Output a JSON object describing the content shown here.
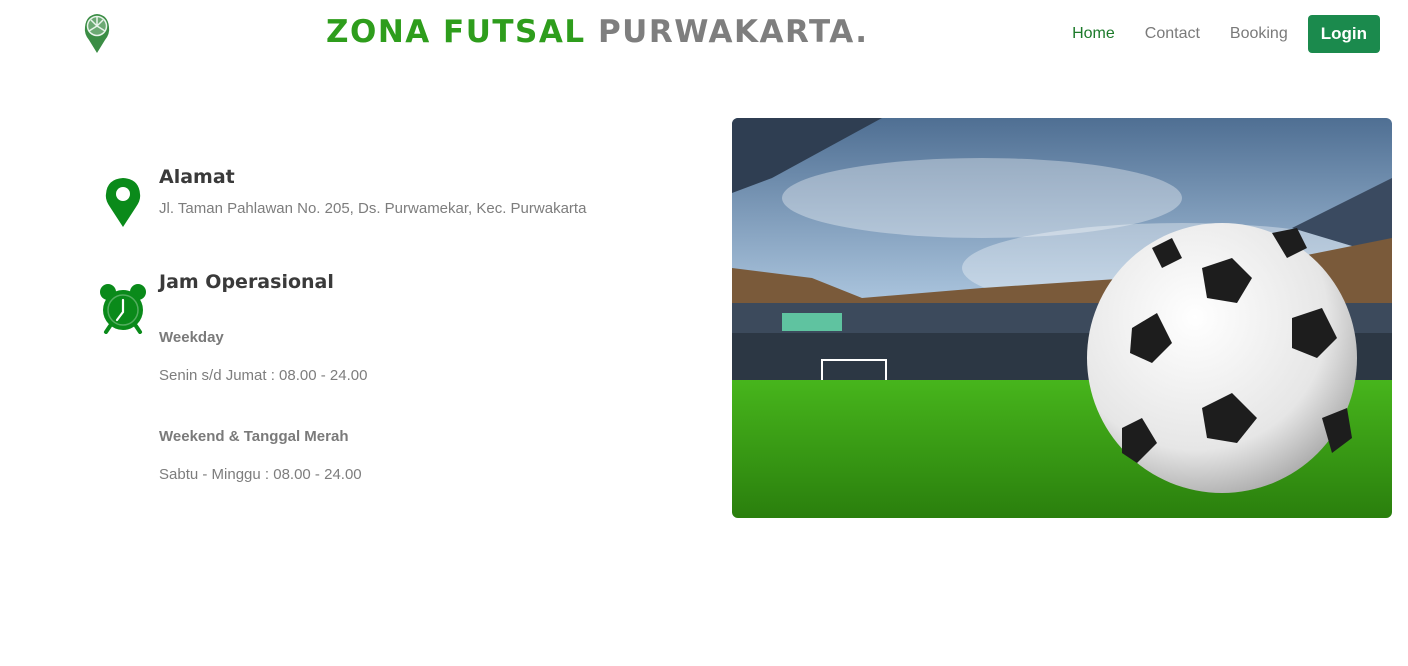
{
  "brand": {
    "part1": "ZONA FUTSAL",
    "part2": "PURWAKARTA."
  },
  "nav": {
    "home": "Home",
    "contact": "Contact",
    "booking": "Booking",
    "login": "Login"
  },
  "address": {
    "title": "Alamat",
    "text": "Jl. Taman Pahlawan No. 205, Ds. Purwamekar, Kec. Purwakarta"
  },
  "hours": {
    "title": "Jam Operasional",
    "weekday_label": "Weekday",
    "weekday_text": "Senin s/d Jumat : 08.00 - 24.00",
    "weekend_label": "Weekend & Tanggal Merah",
    "weekend_text": "Sabtu - Minggu : 08.00 - 24.00"
  },
  "icons": {
    "logo": "soccer-ball-pin-icon",
    "address": "map-pin-icon",
    "hours": "alarm-clock-icon"
  },
  "colors": {
    "brand_green": "#2e9d1c",
    "brand_gray": "#7e7e7e",
    "nav_active": "#1c7a2a",
    "button": "#1b8a4d",
    "icon_green": "#0a8a1a"
  }
}
